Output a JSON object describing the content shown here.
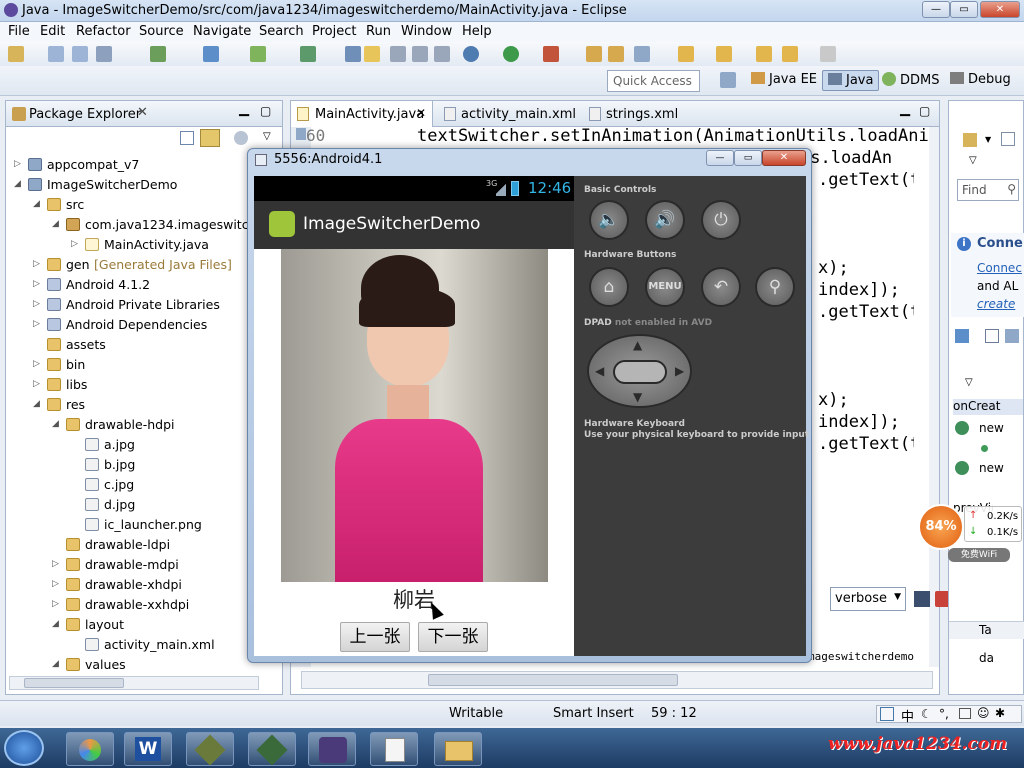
{
  "window": {
    "title": "Java - ImageSwitcherDemo/src/com/java1234/imageswitcherdemo/MainActivity.java - Eclipse"
  },
  "menu": [
    "File",
    "Edit",
    "Refactor",
    "Source",
    "Navigate",
    "Search",
    "Project",
    "Run",
    "Window",
    "Help"
  ],
  "quick_access": {
    "placeholder": "Quick Access"
  },
  "perspectives": [
    "Java EE",
    "Java",
    "DDMS",
    "Debug"
  ],
  "package_explorer": {
    "title": "Package Explorer",
    "items": [
      {
        "label": "appcompat_v7",
        "level": 0,
        "icon": "project-icon",
        "expander": "closed"
      },
      {
        "label": "ImageSwitcherDemo",
        "level": 0,
        "icon": "project-icon",
        "expander": "open"
      },
      {
        "label": "src",
        "level": 1,
        "icon": "folder-icon",
        "expander": "open"
      },
      {
        "label": "com.java1234.imageswitche",
        "level": 2,
        "icon": "package-icon",
        "expander": "open"
      },
      {
        "label": "MainActivity.java",
        "level": 3,
        "icon": "java-file-icon",
        "expander": "closed"
      },
      {
        "label": "gen",
        "level": 1,
        "icon": "folder-icon",
        "expander": "closed",
        "suffix": "[Generated Java Files]"
      },
      {
        "label": "Android 4.1.2",
        "level": 1,
        "icon": "library-icon",
        "expander": "closed"
      },
      {
        "label": "Android Private Libraries",
        "level": 1,
        "icon": "library-icon",
        "expander": "closed"
      },
      {
        "label": "Android Dependencies",
        "level": 1,
        "icon": "library-icon",
        "expander": "closed"
      },
      {
        "label": "assets",
        "level": 1,
        "icon": "folder-icon",
        "expander": "none"
      },
      {
        "label": "bin",
        "level": 1,
        "icon": "folder-icon",
        "expander": "closed"
      },
      {
        "label": "libs",
        "level": 1,
        "icon": "folder-icon",
        "expander": "closed"
      },
      {
        "label": "res",
        "level": 1,
        "icon": "folder-icon",
        "expander": "open"
      },
      {
        "label": "drawable-hdpi",
        "level": 2,
        "icon": "folder-icon",
        "expander": "open"
      },
      {
        "label": "a.jpg",
        "level": 3,
        "icon": "image-file-icon",
        "expander": "none"
      },
      {
        "label": "b.jpg",
        "level": 3,
        "icon": "image-file-icon",
        "expander": "none"
      },
      {
        "label": "c.jpg",
        "level": 3,
        "icon": "image-file-icon",
        "expander": "none"
      },
      {
        "label": "d.jpg",
        "level": 3,
        "icon": "image-file-icon",
        "expander": "none"
      },
      {
        "label": "ic_launcher.png",
        "level": 3,
        "icon": "image-file-icon",
        "expander": "none"
      },
      {
        "label": "drawable-ldpi",
        "level": 2,
        "icon": "folder-icon",
        "expander": "none"
      },
      {
        "label": "drawable-mdpi",
        "level": 2,
        "icon": "folder-icon",
        "expander": "closed"
      },
      {
        "label": "drawable-xhdpi",
        "level": 2,
        "icon": "folder-icon",
        "expander": "closed"
      },
      {
        "label": "drawable-xxhdpi",
        "level": 2,
        "icon": "folder-icon",
        "expander": "closed"
      },
      {
        "label": "layout",
        "level": 2,
        "icon": "folder-icon",
        "expander": "open"
      },
      {
        "label": "activity_main.xml",
        "level": 3,
        "icon": "xml-file-icon",
        "expander": "none"
      },
      {
        "label": "values",
        "level": 2,
        "icon": "folder-icon",
        "expander": "open"
      },
      {
        "label": "strings.xml",
        "level": 3,
        "icon": "xml-file-icon",
        "expander": "none"
      }
    ]
  },
  "editor": {
    "tabs": [
      "MainActivity.java",
      "activity_main.xml",
      "strings.xml"
    ],
    "line_number": "60",
    "lines": [
      "textSwitcher.setInAnimation(AnimationUtils.loadAni",
      "ls.loadAn",
      ".getText(t",
      "x);",
      "index]);",
      ".getText(t",
      "x);",
      "index]);",
      ".getText(t"
    ]
  },
  "right_panel": {
    "find_placeholder": "Find",
    "connect_title": "Conne",
    "connect_link1": "Connec",
    "connect_text": "and AL",
    "connect_link2": "create",
    "outline_header": "onCreat",
    "outline_items": [
      "new",
      "new"
    ],
    "outline_tail": "prevVie",
    "column_header": "Ta",
    "column_value": "da"
  },
  "network_widget": {
    "percent": "84%",
    "up": "0.2K/s",
    "down": "0.1K/s",
    "label": "免费WiFi"
  },
  "logcat": {
    "level": "verbose",
    "row_text": "mageswitcherdemo"
  },
  "emulator": {
    "title": "5556:Android4.1",
    "status_time": "12:46",
    "signal": "3G",
    "app_title": "ImageSwitcherDemo",
    "caption": "柳岩",
    "prev_button": "上一张",
    "next_button": "下一张",
    "basic_controls": "Basic Controls",
    "hardware_buttons": "Hardware Buttons",
    "menu_label": "MENU",
    "dpad": "DPAD",
    "dpad_note": "not enabled in AVD",
    "kb_title": "Hardware Keyboard",
    "kb_note": "Use your physical keyboard to provide input"
  },
  "status": {
    "writable": "Writable",
    "insert_mode": "Smart Insert",
    "position": "59 : 12"
  },
  "ime_tray": "中",
  "watermark": "www.java1234.com"
}
